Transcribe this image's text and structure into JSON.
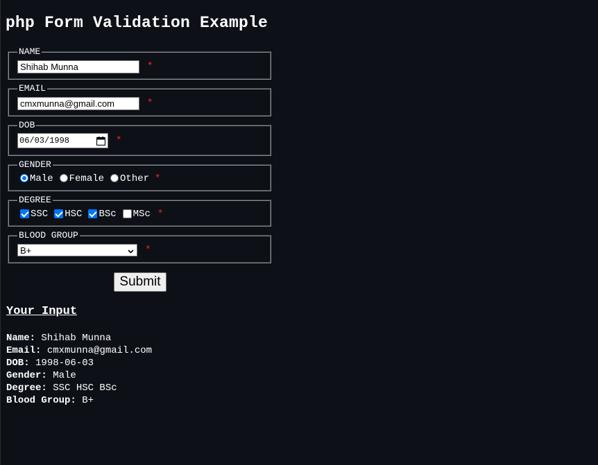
{
  "page": {
    "title": "php Form Validation Example"
  },
  "form": {
    "required_mark": "*",
    "name": {
      "legend": "NAME",
      "value": "Shihab Munna"
    },
    "email": {
      "legend": "EMAIL",
      "value": "cmxmunna@gmail.com"
    },
    "dob": {
      "legend": "DOB",
      "value": "06/03/1998",
      "icon": "calendar-icon"
    },
    "gender": {
      "legend": "GENDER",
      "options": [
        {
          "label": "Male",
          "checked": true
        },
        {
          "label": "Female",
          "checked": false
        },
        {
          "label": "Other",
          "checked": false
        }
      ]
    },
    "degree": {
      "legend": "DEGREE",
      "options": [
        {
          "label": "SSC",
          "checked": true
        },
        {
          "label": "HSC",
          "checked": true
        },
        {
          "label": "BSc",
          "checked": true
        },
        {
          "label": "MSc",
          "checked": false
        }
      ]
    },
    "blood_group": {
      "legend": "BLOOD GROUP",
      "selected": "B+",
      "icon": "chevron-down-icon"
    },
    "submit_label": "Submit"
  },
  "output": {
    "heading": "Your Input",
    "rows": [
      {
        "label": "Name:",
        "value": "Shihab Munna"
      },
      {
        "label": "Email:",
        "value": "cmxmunna@gmail.com"
      },
      {
        "label": "DOB:",
        "value": "1998-06-03"
      },
      {
        "label": "Gender:",
        "value": "Male"
      },
      {
        "label": "Degree:",
        "value": "SSC HSC BSc"
      },
      {
        "label": "Blood Group:",
        "value": "B+"
      }
    ]
  },
  "colors": {
    "background": "#0d1117",
    "required": "#ff2020",
    "accent": "#0075ff"
  }
}
